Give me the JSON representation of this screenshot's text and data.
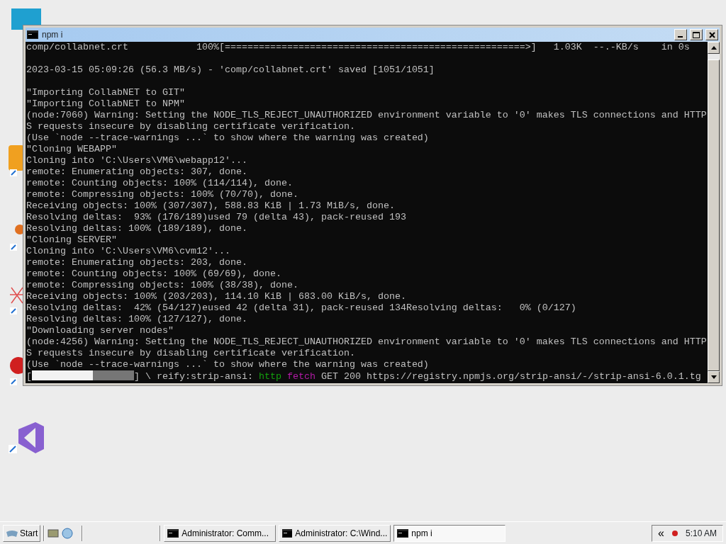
{
  "window": {
    "title": "npm i",
    "lines": [
      {
        "kind": "text",
        "text": "comp/collabnet.crt            100%[=====================================================>]   1.03K  --.-KB/s    in 0s"
      },
      {
        "kind": "blank"
      },
      {
        "kind": "text",
        "text": "2023-03-15 05:09:26 (56.3 MB/s) - 'comp/collabnet.crt' saved [1051/1051]"
      },
      {
        "kind": "blank"
      },
      {
        "kind": "text",
        "text": "\"Importing CollabNET to GIT\""
      },
      {
        "kind": "text",
        "text": "\"Importing CollabNET to NPM\""
      },
      {
        "kind": "text",
        "text": "(node:7060) Warning: Setting the NODE_TLS_REJECT_UNAUTHORIZED environment variable to '0' makes TLS connections and HTTP"
      },
      {
        "kind": "text",
        "text": "S requests insecure by disabling certificate verification."
      },
      {
        "kind": "text",
        "text": "(Use `node --trace-warnings ...` to show where the warning was created)"
      },
      {
        "kind": "text",
        "text": "\"Cloning WEBAPP\""
      },
      {
        "kind": "text",
        "text": "Cloning into 'C:\\Users\\VM6\\webapp12'..."
      },
      {
        "kind": "text",
        "text": "remote: Enumerating objects: 307, done."
      },
      {
        "kind": "text",
        "text": "remote: Counting objects: 100% (114/114), done."
      },
      {
        "kind": "text",
        "text": "remote: Compressing objects: 100% (70/70), done."
      },
      {
        "kind": "text",
        "text": "Receiving objects: 100% (307/307), 588.83 KiB | 1.73 MiB/s, done."
      },
      {
        "kind": "text",
        "text": "Resolving deltas:  93% (176/189)used 79 (delta 43), pack-reused 193"
      },
      {
        "kind": "text",
        "text": "Resolving deltas: 100% (189/189), done."
      },
      {
        "kind": "text",
        "text": "\"Cloning SERVER\""
      },
      {
        "kind": "text",
        "text": "Cloning into 'C:\\Users\\VM6\\cvm12'..."
      },
      {
        "kind": "text",
        "text": "remote: Enumerating objects: 203, done."
      },
      {
        "kind": "text",
        "text": "remote: Counting objects: 100% (69/69), done."
      },
      {
        "kind": "text",
        "text": "remote: Compressing objects: 100% (38/38), done."
      },
      {
        "kind": "text",
        "text": "Receiving objects: 100% (203/203), 114.10 KiB | 683.00 KiB/s, done."
      },
      {
        "kind": "text",
        "text": "Resolving deltas:  42% (54/127)eused 42 (delta 31), pack-reused 134Resolving deltas:   0% (0/127)"
      },
      {
        "kind": "text",
        "text": "Resolving deltas: 100% (127/127), done."
      },
      {
        "kind": "text",
        "text": "\"Downloading server nodes\""
      },
      {
        "kind": "text",
        "text": "(node:4256) Warning: Setting the NODE_TLS_REJECT_UNAUTHORIZED environment variable to '0' makes TLS connections and HTTP"
      },
      {
        "kind": "text",
        "text": "S requests insecure by disabling certificate verification."
      },
      {
        "kind": "text",
        "text": "(Use `node --trace-warnings ...` to show where the warning was created)"
      },
      {
        "kind": "progress",
        "open": "[",
        "close": "]",
        "level": 0.6,
        "segments": [
          {
            "text": " \\ reify:strip-ansi: ",
            "color": "#c0c0c0"
          },
          {
            "text": "http",
            "color": "#13a10e"
          },
          {
            "text": " fetch",
            "color": "#b41ca8"
          },
          {
            "text": " GET 200 https://registry.npmjs.org/strip-ansi/-/strip-ansi-6.0.1.tg",
            "color": "#c0c0c0"
          }
        ]
      }
    ]
  },
  "taskbar": {
    "start": "Start",
    "tasks": [
      {
        "label": "Administrator:  Comm...",
        "selected": false
      },
      {
        "label": "Administrator: C:\\Wind...",
        "selected": false
      },
      {
        "label": "npm i",
        "selected": true
      }
    ],
    "tray_button": "«",
    "clock": "5:10 AM"
  }
}
